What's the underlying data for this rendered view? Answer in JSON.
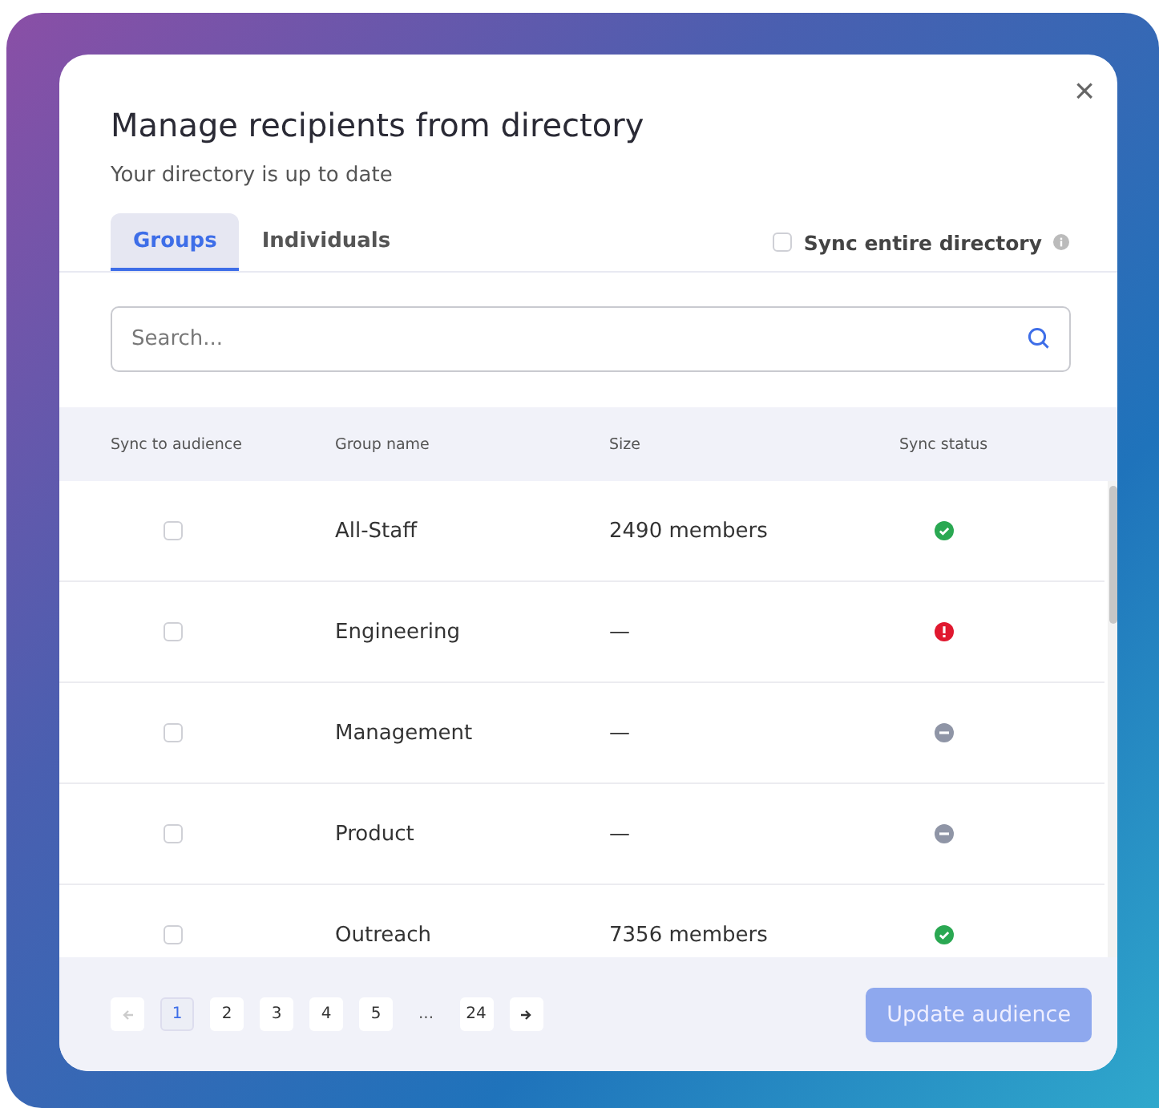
{
  "dialog": {
    "title": "Manage recipients from directory",
    "subtitle": "Your directory is up to date",
    "close": "×"
  },
  "tabs": [
    {
      "label": "Groups",
      "selected": true
    },
    {
      "label": "Individuals",
      "selected": false
    }
  ],
  "sync_entire_directory": {
    "label": "Sync entire directory",
    "checked": false
  },
  "search": {
    "placeholder": "Search..."
  },
  "table": {
    "columns": [
      "Sync to audience",
      "Group name",
      "Size",
      "Sync status"
    ],
    "rows": [
      {
        "checked": false,
        "name": "All-Staff",
        "size": "2490 members",
        "kind": "ok"
      },
      {
        "checked": false,
        "name": "Engineering",
        "size": "—",
        "kind": "error"
      },
      {
        "checked": false,
        "name": "Management",
        "size": "—",
        "kind": "none"
      },
      {
        "checked": false,
        "name": "Product",
        "size": "—",
        "kind": "none"
      },
      {
        "checked": false,
        "name": "Outreach",
        "size": "7356 members",
        "kind": "ok"
      }
    ]
  },
  "pagination": {
    "pages": [
      {
        "label": "1",
        "selected": true
      },
      {
        "label": "2",
        "selected": false
      },
      {
        "label": "3",
        "selected": false
      },
      {
        "label": "4",
        "selected": false
      },
      {
        "label": "5",
        "selected": false
      },
      {
        "label": "...",
        "kind": "ellipsis"
      },
      {
        "label": "24",
        "selected": false
      }
    ],
    "prev_disabled": true
  },
  "primary_button": {
    "label": "Update audience",
    "disabled": true
  }
}
